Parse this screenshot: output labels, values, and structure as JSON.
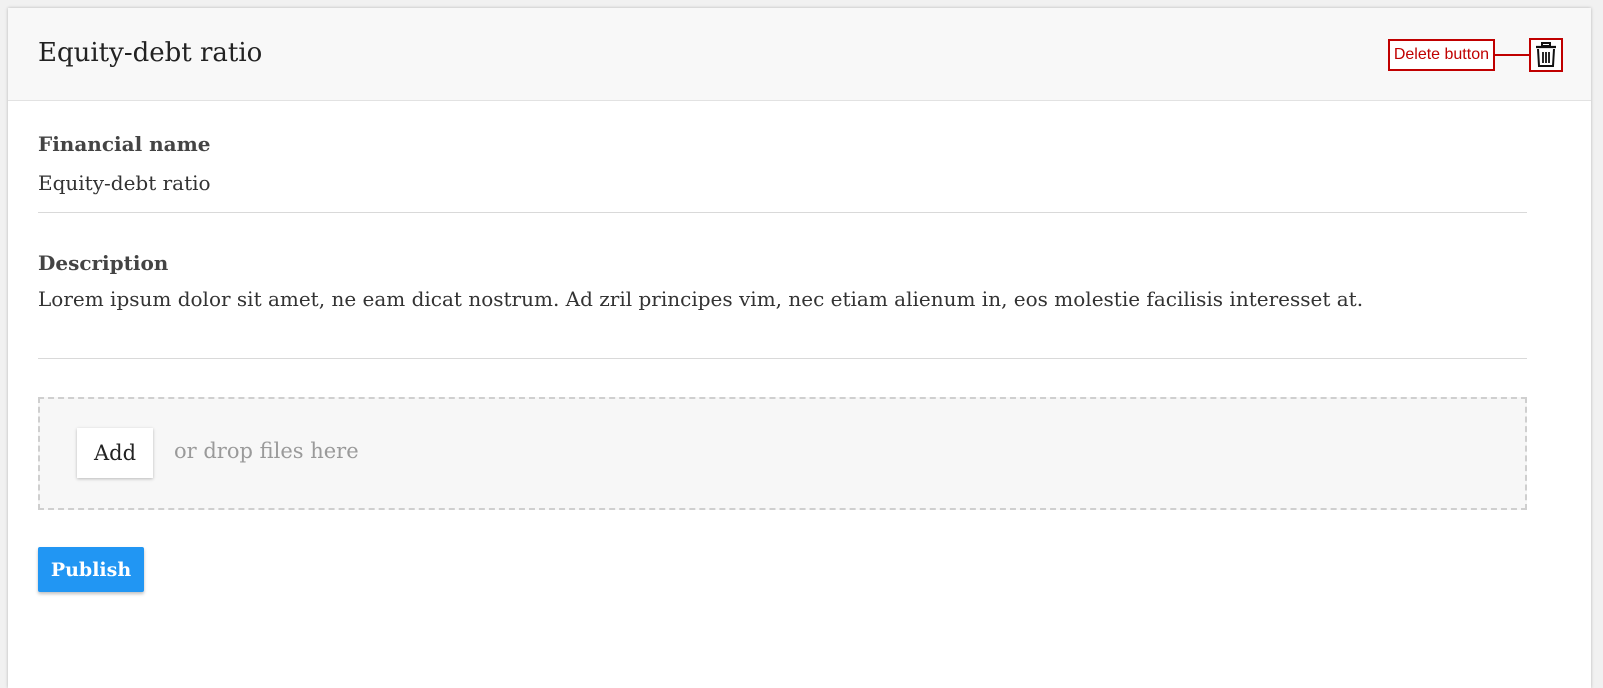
{
  "card": {
    "title": "Equity-debt ratio",
    "delete_annotation": "Delete button",
    "delete_icon": "trash-icon"
  },
  "form": {
    "financial_name": {
      "label": "Financial name",
      "value": "Equity-debt ratio"
    },
    "description": {
      "label": "Description",
      "value": "Lorem ipsum dolor sit amet, ne eam dicat nostrum. Ad zril principes vim, nec etiam alienum in, eos molestie facilisis interesset at."
    },
    "upload": {
      "add_label": "Add",
      "hint": "or drop files here"
    },
    "publish_label": "Publish"
  },
  "colors": {
    "primary": "#2196f3",
    "annotation": "#c00000"
  }
}
